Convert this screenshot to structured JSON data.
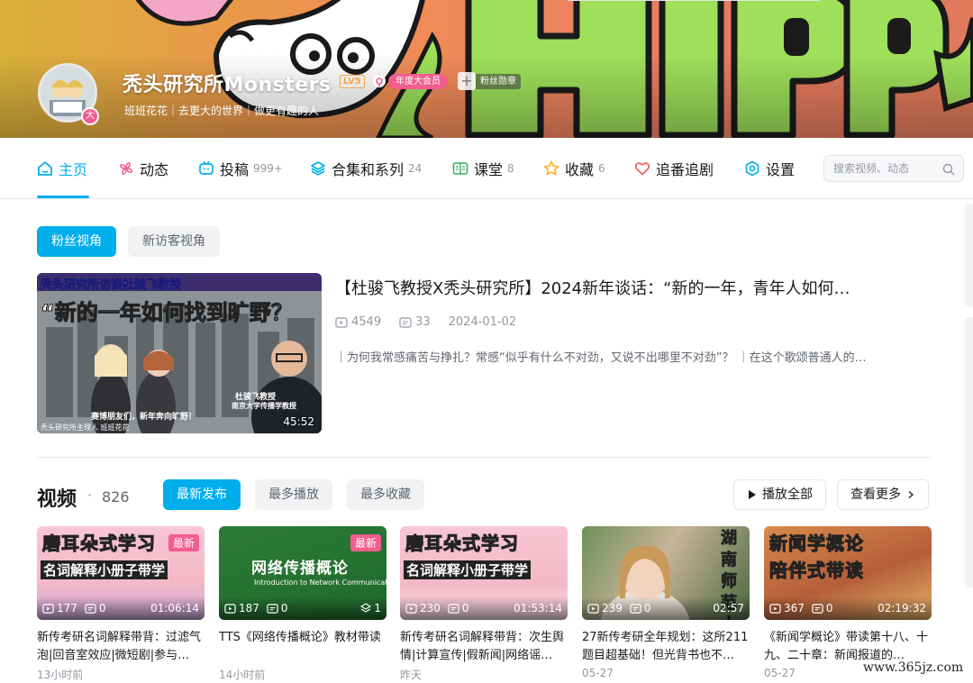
{
  "profile": {
    "name": "秃头研究所Monsters",
    "level": "LV5",
    "year_badge": "年度大会员",
    "fan_medal": "粉丝勋章",
    "sign": "班班花花｜去更大的世界｜做更有趣的人",
    "avatar_badge": "大"
  },
  "nav": {
    "items": [
      {
        "label": "主页",
        "count": "",
        "icon": "home-icon",
        "active": true
      },
      {
        "label": "动态",
        "count": "",
        "icon": "pinwheel-icon"
      },
      {
        "label": "投稿",
        "count": "999+",
        "icon": "tv-icon"
      },
      {
        "label": "合集和系列",
        "count": "24",
        "icon": "layers-icon"
      },
      {
        "label": "课堂",
        "count": "8",
        "icon": "book-icon"
      },
      {
        "label": "收藏",
        "count": "6",
        "icon": "star-icon"
      },
      {
        "label": "追番追剧",
        "count": "",
        "icon": "heart-icon"
      },
      {
        "label": "设置",
        "count": "",
        "icon": "gear-icon"
      }
    ],
    "search_placeholder": "搜索视频、动态"
  },
  "view_toggle": {
    "fan": "粉丝视角",
    "visitor": "新访客视角"
  },
  "featured": {
    "title": "【杜骏飞教授X秃头研究所】2024新年谈话：“新的一年，青年人如何…",
    "plays": "4549",
    "comments": "33",
    "date": "2024-01-02",
    "desc": "｜为何我常感痛苦与挣扎？常感“似乎有什么不对劲，又说不出哪里不对劲”？ ｜在这个歌颂普通人的…",
    "duration": "45:52",
    "thumb_caption_1": "秃头研究所访谈杜骏飞教授",
    "thumb_caption_2": "“新的一年如何找到旷野？",
    "thumb_caption_3": "赛博朋友们，新年奔向旷野！",
    "thumb_name": "杜骏飞教授",
    "thumb_role": "南京大学传播学教授",
    "thumb_footer": "秃头研究所主理人 班班花花"
  },
  "videos": {
    "title": "视频",
    "dot": "·",
    "count": "826",
    "sort": [
      "最新发布",
      "最多播放",
      "最多收藏"
    ],
    "play_all": "播放全部",
    "see_more": "查看更多",
    "new_label": "最新",
    "items": [
      {
        "cap": "磨耳朵式学习",
        "cap2": "名词解释小册子带学",
        "plays": "177",
        "comments": "0",
        "duration": "01:06:14",
        "title": "新传考研名词解释带背：过滤气泡|回音室效应|微短剧|参与…",
        "date": "13小时前",
        "is_new": true
      },
      {
        "cap": "网络传播概论",
        "cap2": "Introduction to Network Communication",
        "plays": "187",
        "comments": "0",
        "duration": "1",
        "title": "TTS《网络传播概论》教材带读",
        "date": "14小时前",
        "is_new": true
      },
      {
        "cap": "磨耳朵式学习",
        "cap2": "名词解释小册子带学",
        "plays": "230",
        "comments": "0",
        "duration": "01:53:14",
        "title": "新传考研名词解释带背：次生舆情|计算宣传|假新闻|网络谣…",
        "date": "昨天",
        "is_new": false
      },
      {
        "cap": "湖南师范大学",
        "cap2": "",
        "plays": "239",
        "comments": "0",
        "duration": "02:57",
        "title": "27新传考研全年规划：这所211题目超基础！但光背书也不…",
        "date": "05-27",
        "is_new": false
      },
      {
        "cap": "新闻学概论",
        "cap2": "陪伴式带读",
        "plays": "367",
        "comments": "0",
        "duration": "02:19:32",
        "title": "《新闻学概论》带读第十八、十九、二十章：新闻报道的…",
        "date": "05-27",
        "is_new": false
      }
    ]
  },
  "banner_text": "HIPPO!",
  "watermark": "www.365jz.com",
  "colors": {
    "accent": "#00aeec",
    "pink": "#f25d8e",
    "text": "#18191c",
    "muted": "#9499a0"
  }
}
